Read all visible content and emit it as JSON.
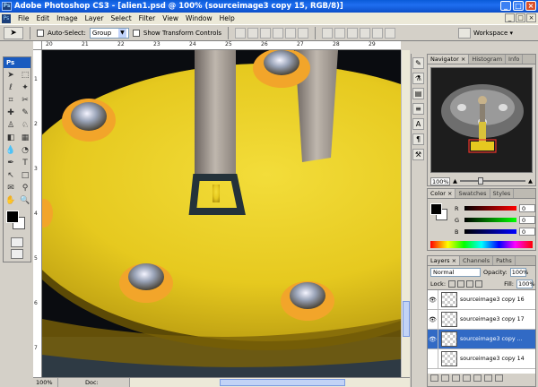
{
  "window": {
    "title": "Adobe Photoshop CS3 - [alien1.psd @ 100% (sourceimage3 copy 15, RGB/8)]",
    "app_badge": "Ps",
    "controls": [
      "_",
      "□",
      "×"
    ],
    "doc_controls": [
      "_",
      "□",
      "×"
    ]
  },
  "menu": [
    "File",
    "Edit",
    "Image",
    "Layer",
    "Select",
    "Filter",
    "View",
    "Window",
    "Help"
  ],
  "options": {
    "auto_select_label": "Auto-Select:",
    "auto_select_value": "Group",
    "show_transform_label": "Show Transform Controls",
    "workspace_label": "Workspace ▾"
  },
  "toolbox": {
    "logo": "Ps",
    "tools": [
      "move-icon",
      "marquee-icon",
      "lasso-icon",
      "magic-wand-icon",
      "crop-icon",
      "slice-icon",
      "healing-icon",
      "brush-icon",
      "stamp-icon",
      "history-brush-icon",
      "eraser-icon",
      "gradient-icon",
      "blur-icon",
      "dodge-icon",
      "pen-icon",
      "type-icon",
      "path-select-icon",
      "shape-icon",
      "notes-icon",
      "eyedropper-icon",
      "hand-icon",
      "zoom-icon"
    ],
    "glyphs": [
      "➤",
      "⬚",
      "ℓ",
      "✦",
      "⌗",
      "✂",
      "✚",
      "✎",
      "♙",
      "♘",
      "◧",
      "▦",
      "💧",
      "◔",
      "✒",
      "T",
      "↖",
      "□",
      "✉",
      "⚲",
      "✋",
      "🔍"
    ]
  },
  "rulers": {
    "top": [
      "20",
      "21",
      "22",
      "23",
      "24",
      "25",
      "26",
      "27",
      "28",
      "29"
    ],
    "left": [
      "1",
      "2",
      "3",
      "4",
      "5",
      "6",
      "7"
    ]
  },
  "status": {
    "zoom": "100%",
    "doc": "Doc: 45.8M/755.1M"
  },
  "navigator": {
    "tabs": [
      "Navigator ×",
      "Histogram",
      "Info"
    ],
    "zoom": "100%"
  },
  "color": {
    "tabs": [
      "Color ×",
      "Swatches",
      "Styles"
    ],
    "channels": [
      {
        "label": "R",
        "value": "0",
        "track": "linear-gradient(90deg,#000,#f00)"
      },
      {
        "label": "G",
        "value": "0",
        "track": "linear-gradient(90deg,#000,#0f0)"
      },
      {
        "label": "B",
        "value": "0",
        "track": "linear-gradient(90deg,#000,#00f)"
      }
    ]
  },
  "layers": {
    "tabs": [
      "Layers ×",
      "Channels",
      "Paths"
    ],
    "blend_mode": "Normal",
    "opacity_label": "Opacity:",
    "opacity": "100%",
    "lock_label": "Lock:",
    "fill_label": "Fill:",
    "fill": "100%",
    "items": [
      {
        "name": "sourceimage3 copy 16",
        "visible": true,
        "selected": false
      },
      {
        "name": "sourceimage3 copy 17",
        "visible": true,
        "selected": false
      },
      {
        "name": "sourceimage3 copy ...",
        "visible": true,
        "selected": true
      },
      {
        "name": "sourceimage3 copy 14",
        "visible": false,
        "selected": false
      }
    ]
  },
  "rightstrip": [
    "✎",
    "⚗",
    "▤",
    "≡",
    "A",
    "¶",
    "⚒"
  ],
  "colors": {
    "accent": "#316ac5",
    "ufo_yellow": "#e9cf24",
    "canvas_bg": "#1c2024"
  }
}
